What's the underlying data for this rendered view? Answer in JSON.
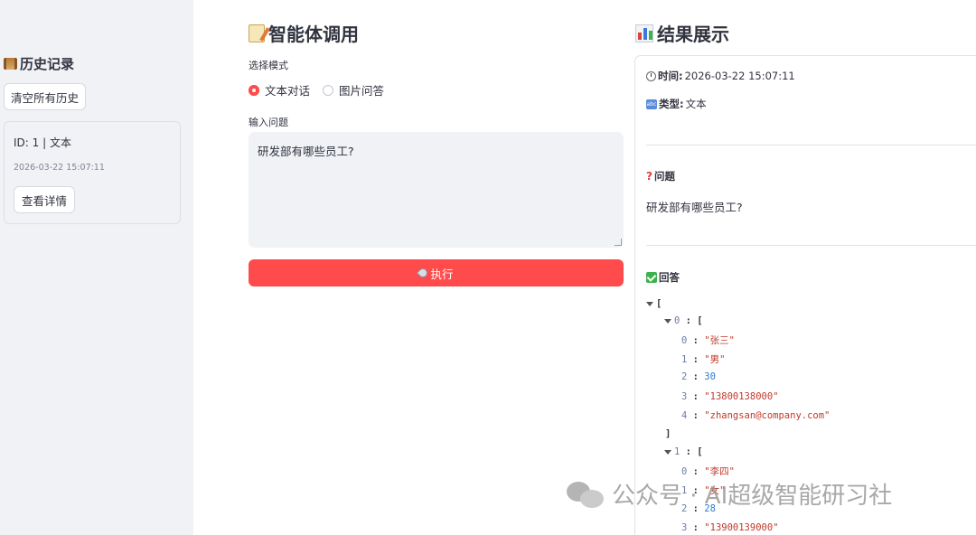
{
  "sidebar": {
    "title": "历史记录",
    "clear_button": "清空所有历史",
    "history": [
      {
        "id_label": "ID: 1 | 文本",
        "time": "2026-03-22 15:07:11",
        "detail_button": "查看详情"
      }
    ]
  },
  "main": {
    "title": "智能体调用",
    "mode_label": "选择模式",
    "modes": [
      {
        "label": "文本对话",
        "selected": true
      },
      {
        "label": "图片问答",
        "selected": false
      }
    ],
    "input_label": "输入问题",
    "input_value": "研发部有哪些员工?",
    "execute_button": "执行"
  },
  "result": {
    "title": "结果展示",
    "time_label": "时间:",
    "time_value": "2026-03-22 15:07:11",
    "type_label": "类型:",
    "type_value": "文本",
    "question_heading": "问题",
    "question_text": "研发部有哪些员工?",
    "answer_heading": "回答",
    "json": {
      "open": "[",
      "items": [
        {
          "key": "0",
          "open": "[",
          "close": "]",
          "values": [
            {
              "k": "0",
              "v": "\"张三\"",
              "type": "string"
            },
            {
              "k": "1",
              "v": "\"男\"",
              "type": "string"
            },
            {
              "k": "2",
              "v": "30",
              "type": "number"
            },
            {
              "k": "3",
              "v": "\"13800138000\"",
              "type": "string"
            },
            {
              "k": "4",
              "v": "\"zhangsan@company.com\"",
              "type": "string"
            }
          ]
        },
        {
          "key": "1",
          "open": "[",
          "values": [
            {
              "k": "0",
              "v": "\"李四\"",
              "type": "string"
            },
            {
              "k": "1",
              "v": "\"女\"",
              "type": "string"
            },
            {
              "k": "2",
              "v": "28",
              "type": "number"
            },
            {
              "k": "3",
              "v": "\"13900139000\"",
              "type": "string"
            }
          ]
        }
      ]
    }
  },
  "watermark": {
    "text": "公众号 · AI超级智能研习社"
  },
  "colors": {
    "primary": "#ff4b4b",
    "sidebar_bg": "#f0f2f6",
    "text": "#31333f"
  }
}
